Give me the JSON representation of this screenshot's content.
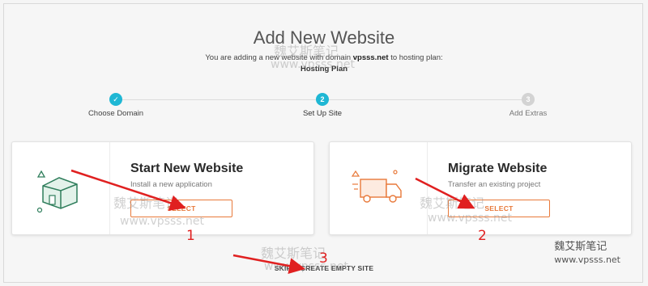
{
  "header": {
    "title": "Add New Website",
    "subtitle_prefix": "You are adding a new website with domain",
    "domain": "vpsss.net",
    "subtitle_suffix": "to hosting plan:",
    "plan": "Hosting Plan"
  },
  "steps": [
    {
      "label": "Choose Domain",
      "marker": "✓",
      "state": "done",
      "color": "#1fb7d4"
    },
    {
      "label": "Set Up Site",
      "marker": "2",
      "state": "active",
      "color": "#1fb7d4"
    },
    {
      "label": "Add Extras",
      "marker": "3",
      "state": "pending",
      "color": "#d3d3d3"
    }
  ],
  "cards": [
    {
      "title": "Start New Website",
      "description": "Install a new application",
      "button": "SELECT",
      "icon": "house-icon"
    },
    {
      "title": "Migrate Website",
      "description": "Transfer an existing project",
      "button": "SELECT",
      "icon": "moving-truck-icon"
    }
  ],
  "skip_link": "SKIP & CREATE EMPTY SITE",
  "annotations": [
    "1",
    "2",
    "3"
  ],
  "watermark": {
    "cn": "魏艾斯笔记",
    "url": "www.vpsss.net"
  },
  "colors": {
    "accent": "#e8793a",
    "step": "#1fb7d4",
    "annotation": "#e02020",
    "icon_green": "#2e7d5b"
  }
}
